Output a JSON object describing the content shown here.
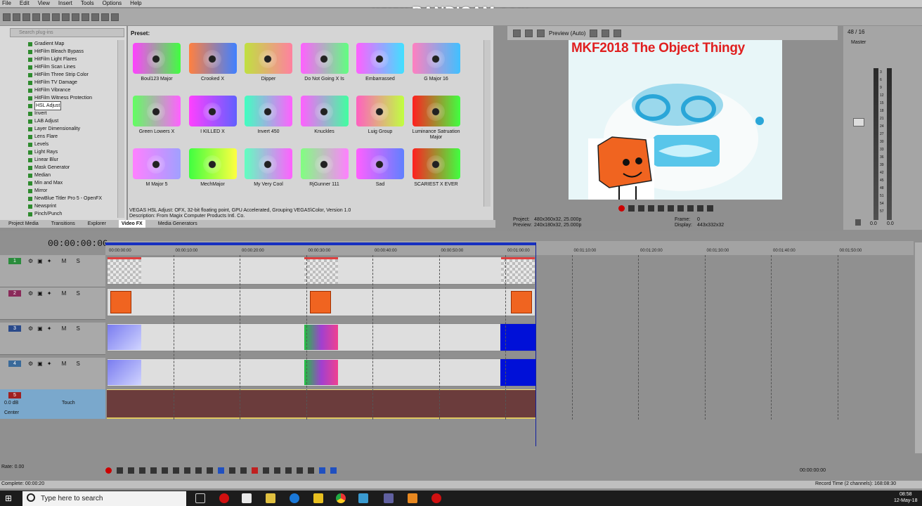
{
  "menu": [
    "File",
    "Edit",
    "View",
    "Insert",
    "Tools",
    "Options",
    "Help"
  ],
  "watermark": "www.BANDICAM.com",
  "plugins": {
    "search_placeholder": "Search plug-ins",
    "items": [
      "Gradient Map",
      "HitFilm Bleach Bypass",
      "HitFilm Light Flares",
      "HitFilm Scan Lines",
      "HitFilm Three Strip Color",
      "HitFilm TV Damage",
      "HitFilm Vibrance",
      "HitFilm Witness Protection",
      "HSL Adjust",
      "Invert",
      "LAB Adjust",
      "Layer Dimensionality",
      "Lens Flare",
      "Levels",
      "Light Rays",
      "Linear Blur",
      "Mask Generator",
      "Median",
      "Min and Max",
      "Mirror",
      "NewBlue Titler Pro 5 - OpenFX",
      "Newsprint",
      "Pinch/Punch"
    ],
    "selected": "HSL Adjust"
  },
  "presets": {
    "label": "Preset:",
    "items": [
      {
        "name": "Boul123 Major",
        "color": "linear-gradient(90deg,#ff40ff,#40ff40)"
      },
      {
        "name": "Crooked X",
        "color": "linear-gradient(90deg,#ff8040,#4080ff)"
      },
      {
        "name": "Dipper",
        "color": "linear-gradient(90deg,#c0e040,#ff80a0)"
      },
      {
        "name": "Do Not Going X Is",
        "color": "linear-gradient(90deg,#ff60ff,#60ff80)"
      },
      {
        "name": "Embarrassed",
        "color": "linear-gradient(90deg,#ff60ff,#40e0ff)"
      },
      {
        "name": "G Major 16",
        "color": "linear-gradient(90deg,#ff80c0,#40c0ff)"
      },
      {
        "name": "Green Lowers X",
        "color": "linear-gradient(90deg,#60ff60,#ff60ff)"
      },
      {
        "name": "I KILLED X",
        "color": "linear-gradient(90deg,#ff40ff,#6060ff)"
      },
      {
        "name": "Invert 450",
        "color": "linear-gradient(90deg,#40ffc0,#ff60ff)"
      },
      {
        "name": "Knuckles",
        "color": "linear-gradient(90deg,#ff60ff,#40ffa0)"
      },
      {
        "name": "Luig Group",
        "color": "linear-gradient(90deg,#ff60c0,#c0ff40)"
      },
      {
        "name": "Luminance Satruation Major",
        "color": "linear-gradient(90deg,#ff2020,#40ff40)"
      },
      {
        "name": "M Major 5",
        "color": "linear-gradient(90deg,#ff80ff,#a0a0ff)"
      },
      {
        "name": "MechMajor",
        "color": "linear-gradient(90deg,#40ff40,#ffff40)"
      },
      {
        "name": "My Very Cool",
        "color": "linear-gradient(90deg,#60ffc0,#ff60ff)"
      },
      {
        "name": "RjGunner 111",
        "color": "linear-gradient(90deg,#80ff80,#ff80ff)"
      },
      {
        "name": "Sad",
        "color": "linear-gradient(90deg,#ff60ff,#6080ff)"
      },
      {
        "name": "SCARIEST X EVER",
        "color": "linear-gradient(90deg,#ff2020,#40ff40)"
      }
    ]
  },
  "description_line1": "VEGAS HSL Adjust: OFX, 32-bit floating point, GPU Accelerated, Grouping VEGAS\\Color, Version 1.0",
  "description_line2": "Description: From Magix Computer Products Intl. Co.",
  "bottom_tabs": [
    "Project Media",
    "Transitions",
    "Explorer",
    "Video FX",
    "Media Generators"
  ],
  "active_tab": "Video FX",
  "preview": {
    "mode": "Preview (Auto)",
    "title": "MKF2018 The Object Thingy",
    "project_label": "Project:",
    "project_value": "480x360x32, 25.000p",
    "preview_label": "Preview:",
    "preview_value": "240x180x32, 25.000p",
    "frame_label": "Frame:",
    "frame_value": "0",
    "display_label": "Display:",
    "display_value": "443x332x32"
  },
  "mixer": {
    "counter": "48 / 16",
    "master": "Master",
    "scale": [
      "3",
      "6",
      "9",
      "12",
      "15",
      "18",
      "21",
      "24",
      "27",
      "30",
      "33",
      "36",
      "39",
      "42",
      "45",
      "48",
      "51",
      "54",
      "57"
    ],
    "readout": [
      "0.0",
      "0.0"
    ]
  },
  "timeline": {
    "timecode": "00:00:00:00",
    "ruler": [
      "00:00:00:00",
      "00:00:10:00",
      "00:00:20:00",
      "00:00:30:00",
      "00:00:40:00",
      "00:00:50:00",
      "00:01:00:00",
      "00:01:10:00",
      "00:01:20:00",
      "00:01:30:00",
      "00:01:40:00",
      "00:01:50:00"
    ],
    "tracks": [
      "1",
      "2",
      "3",
      "4"
    ],
    "audio_track": "5",
    "audio_db": "0.0 dB",
    "audio_pan": "Center",
    "audio_mode": "Touch",
    "rate": "Rate: 0.00",
    "bottom_timecode": "00:00:00:00"
  },
  "status": {
    "left": "Complete: 00:00:20",
    "right": "Record Time (2 channels): 168:08:30"
  },
  "taskbar": {
    "search": "Type here to search",
    "time": "08:58",
    "date": "12-May-18"
  }
}
